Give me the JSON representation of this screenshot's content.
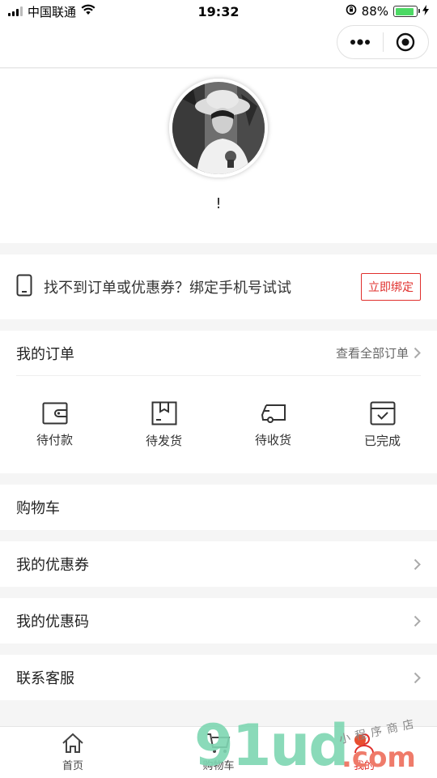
{
  "status_bar": {
    "carrier": "中国联通",
    "time": "19:32",
    "battery_percent": "88%",
    "battery_level": 0.88,
    "wifi_icon": "wifi-icon",
    "colors": {
      "battery_fill": "#4cd964"
    }
  },
  "nav": {
    "more_icon": "more-dots-icon",
    "close_icon": "target-circle-icon"
  },
  "profile": {
    "avatar_icon": "user-avatar-photo",
    "name": "!"
  },
  "bind_phone": {
    "icon": "phone-icon",
    "text": "找不到订单或优惠券？绑定手机号试试",
    "button": "立即绑定"
  },
  "orders": {
    "title": "我的订单",
    "view_all": "查看全部订单",
    "items": [
      {
        "label": "待付款",
        "icon": "wallet-icon"
      },
      {
        "label": "待发货",
        "icon": "package-box-icon"
      },
      {
        "label": "待收货",
        "icon": "delivery-truck-icon"
      },
      {
        "label": "已完成",
        "icon": "completed-checkbox-icon"
      }
    ]
  },
  "menu": {
    "cart": "购物车",
    "coupons": "我的优惠券",
    "promo_codes": "我的优惠码",
    "support": "联系客服"
  },
  "tab_bar": {
    "tabs": [
      {
        "label": "首页",
        "icon": "home-icon"
      },
      {
        "label": "购物车",
        "icon": "cart-icon"
      },
      {
        "label": "我的",
        "icon": "user-icon"
      }
    ],
    "active_color": "#e0302d"
  },
  "watermark": {
    "main": "91ud",
    "domain": ".com",
    "sub": "小程序商店"
  },
  "colors": {
    "accent": "#e0302d",
    "background": "#f5f5f5"
  }
}
